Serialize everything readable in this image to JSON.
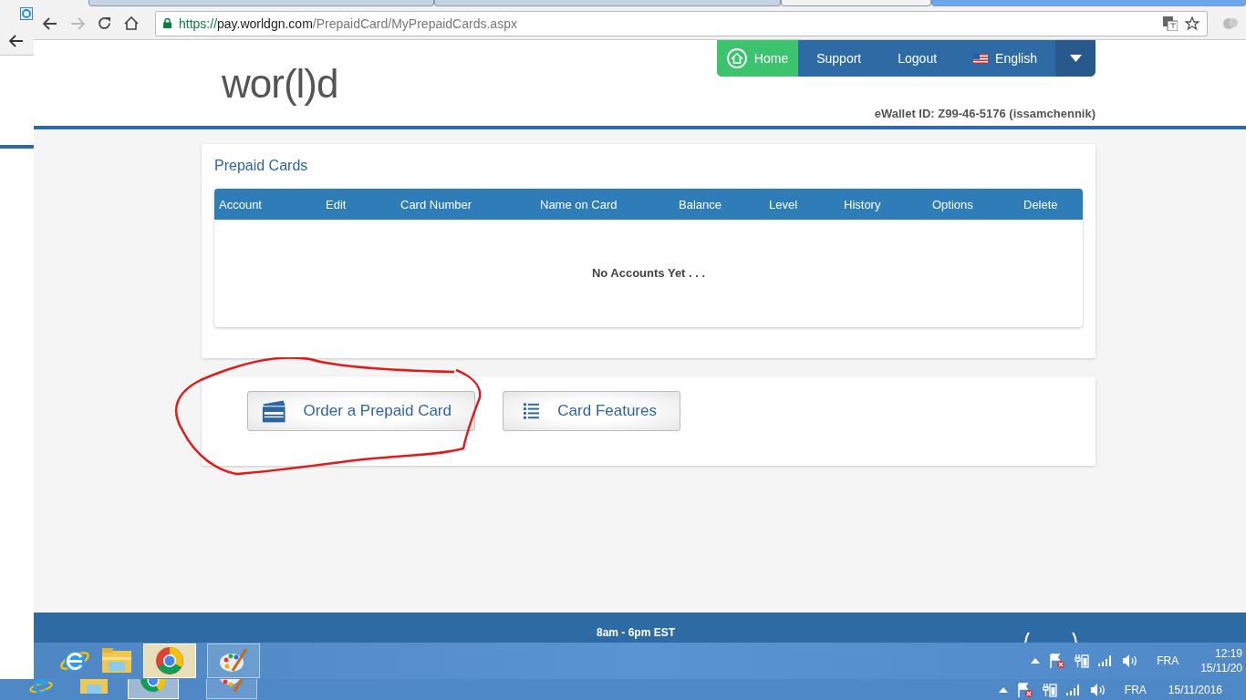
{
  "browser": {
    "url": {
      "scheme": "https://",
      "host": "pay.worldgn.com",
      "path": "/PrepaidCard/MyPrepaidCards.aspx"
    }
  },
  "logo": "wor(l)d",
  "nav": {
    "items": [
      {
        "label": "Home",
        "kind": "home",
        "selected": true
      },
      {
        "label": "Support",
        "kind": "link",
        "selected": false
      },
      {
        "label": "Logout",
        "kind": "link",
        "selected": false
      },
      {
        "label": "English",
        "kind": "language",
        "selected": false
      }
    ]
  },
  "wallet_id": "eWallet ID: Z99-46-5176 (issamchennik)",
  "prepaid_cards": {
    "title": "Prepaid Cards",
    "columns": [
      "Account",
      "Edit",
      "Card Number",
      "Name on Card",
      "Balance",
      "Level",
      "History",
      "Options",
      "Delete"
    ],
    "empty_message": "No Accounts Yet . . ."
  },
  "actions": [
    {
      "label": "Order a Prepaid Card",
      "kind": "card"
    },
    {
      "label": "Card Features",
      "kind": "list"
    }
  ],
  "footer": {
    "hours": "8am - 6pm EST"
  },
  "taskbar": {
    "language": "FRA",
    "time": "12:19",
    "date": "15/11/20"
  },
  "taskbar_behind": {
    "language": "FRA",
    "date": "15/11/2016"
  }
}
